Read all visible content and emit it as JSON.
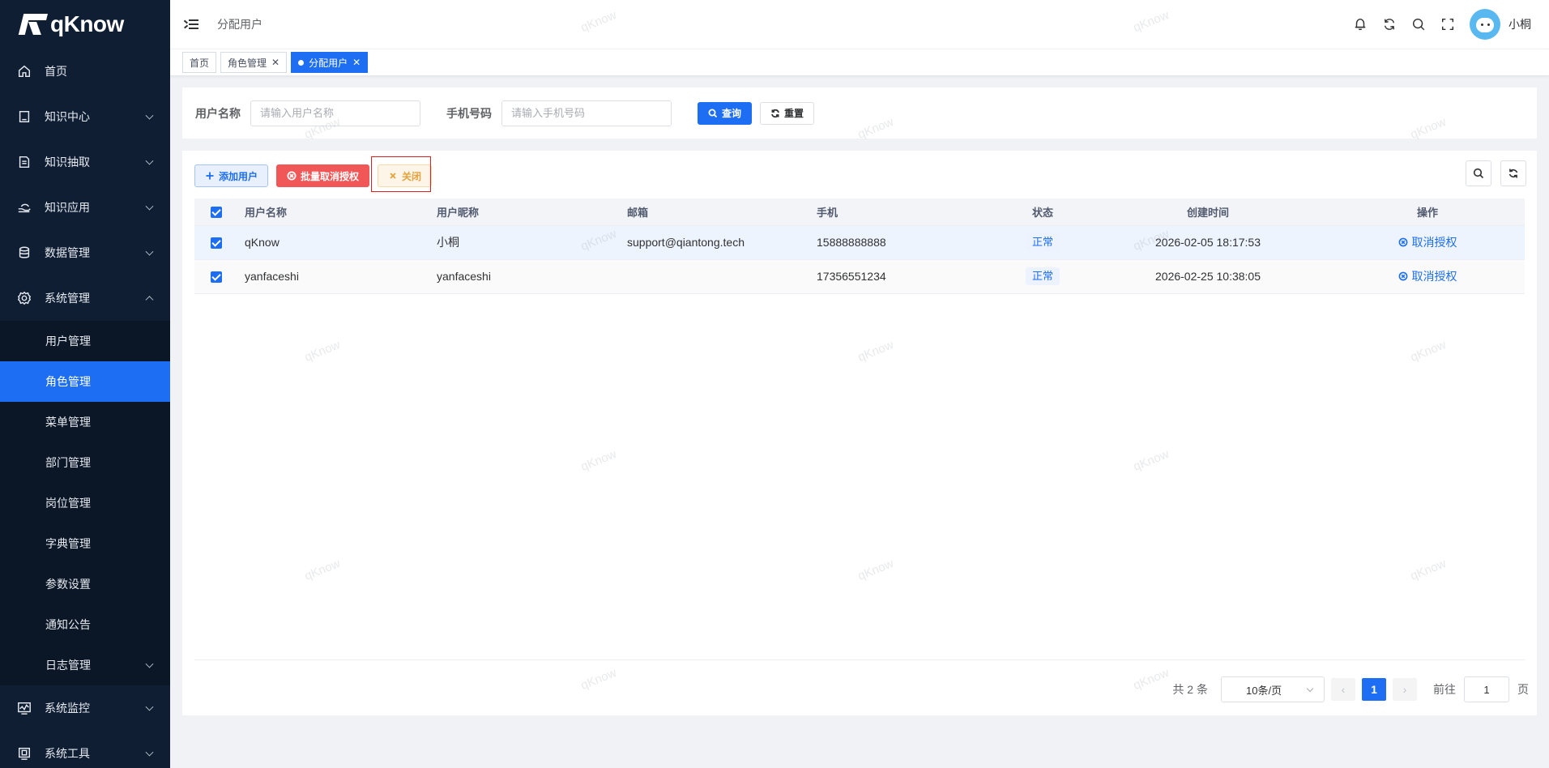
{
  "brand": {
    "name": "qKnow"
  },
  "sidebar": {
    "menus": [
      {
        "label": "首页",
        "icon": "home-icon",
        "has_arrow": false
      },
      {
        "label": "知识中心",
        "icon": "book-icon",
        "has_arrow": true
      },
      {
        "label": "知识抽取",
        "icon": "document-extract-icon",
        "has_arrow": true
      },
      {
        "label": "知识应用",
        "icon": "hand-apply-icon",
        "has_arrow": true
      },
      {
        "label": "数据管理",
        "icon": "database-icon",
        "has_arrow": true
      },
      {
        "label": "系统管理",
        "icon": "gear-icon",
        "has_arrow": true,
        "expanded": true
      }
    ],
    "submenu": [
      {
        "label": "用户管理"
      },
      {
        "label": "角色管理",
        "active": true
      },
      {
        "label": "菜单管理"
      },
      {
        "label": "部门管理"
      },
      {
        "label": "岗位管理"
      },
      {
        "label": "字典管理"
      },
      {
        "label": "参数设置"
      },
      {
        "label": "通知公告"
      },
      {
        "label": "日志管理",
        "has_arrow": true
      }
    ],
    "menus_bottom": [
      {
        "label": "系统监控",
        "icon": "monitor-icon"
      },
      {
        "label": "系统工具",
        "icon": "tool-icon"
      }
    ]
  },
  "header": {
    "breadcrumb": "分配用户",
    "user_name": "小桐"
  },
  "tags": [
    {
      "label": "首页",
      "closable": false
    },
    {
      "label": "角色管理",
      "closable": true
    },
    {
      "label": "分配用户",
      "closable": true,
      "active": true
    }
  ],
  "search": {
    "username_label": "用户名称",
    "username_placeholder": "请输入用户名称",
    "phone_label": "手机号码",
    "phone_placeholder": "请输入手机号码",
    "query_label": "查询",
    "reset_label": "重置"
  },
  "toolbar": {
    "add_label": "添加用户",
    "batch_cancel_label": "批量取消授权",
    "close_label": "关闭"
  },
  "table": {
    "columns": [
      "用户名称",
      "用户昵称",
      "邮箱",
      "手机",
      "状态",
      "创建时间",
      "操作"
    ],
    "rows": [
      {
        "username": "qKnow",
        "nickname": "小桐",
        "email": "support@qiantong.tech",
        "phone": "15888888888",
        "status": "正常",
        "created": "2026-02-05 18:17:53",
        "action": "取消授权"
      },
      {
        "username": "yanfaceshi",
        "nickname": "yanfaceshi",
        "email": "",
        "phone": "17356551234",
        "status": "正常",
        "created": "2026-02-25 10:38:05",
        "action": "取消授权"
      }
    ]
  },
  "pagination": {
    "total_text": "共 2 条",
    "page_size": "10条/页",
    "current_page": "1",
    "goto_label": "前往",
    "goto_value": "1",
    "page_suffix": "页"
  },
  "watermark": "qKnow",
  "colors": {
    "primary": "#1d6ef2",
    "sidebar_bg": "#0f1e33",
    "danger": "#f25757",
    "warning": "#e6a23c"
  }
}
